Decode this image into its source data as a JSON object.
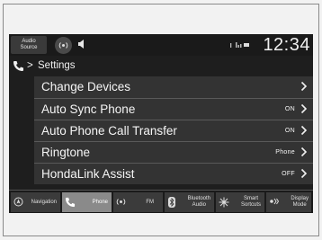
{
  "status_bar": {
    "audio_source_line1": "Audio",
    "audio_source_line2": "Source",
    "clock": "12:34"
  },
  "breadcrumb": {
    "separator": ">",
    "title": "Settings"
  },
  "menu": {
    "items": [
      {
        "label": "Change Devices",
        "value": ""
      },
      {
        "label": "Auto Sync Phone",
        "value": "ON"
      },
      {
        "label": "Auto Phone Call Transfer",
        "value": "ON"
      },
      {
        "label": "Ringtone",
        "value": "Phone"
      },
      {
        "label": "HondaLink Assist",
        "value": "OFF"
      }
    ]
  },
  "nav": {
    "items": [
      {
        "label": "Navigation",
        "icon": "navigation-icon",
        "active": false
      },
      {
        "label": "Phone",
        "icon": "phone-icon",
        "active": true
      },
      {
        "label": "FM",
        "icon": "radio-icon",
        "active": false
      },
      {
        "label_line1": "Bluetooth",
        "label_line2": "Audio",
        "icon": "bluetooth-icon",
        "active": false
      },
      {
        "label_line1": "Smart",
        "label_line2": "Sortcuts",
        "icon": "smart-shortcuts-icon",
        "active": false
      },
      {
        "label_line1": "Display",
        "label_line2": "Mode",
        "icon": "display-mode-icon",
        "active": false
      }
    ]
  }
}
